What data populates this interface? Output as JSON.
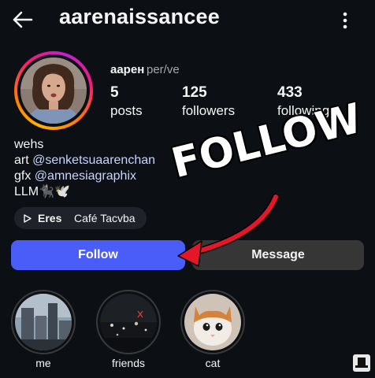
{
  "header": {
    "username": "aarenaissancee",
    "back_icon": "arrow-left-icon",
    "menu_icon": "more-vertical-icon"
  },
  "profile": {
    "display_name": "аарен",
    "pronouns": "per/ve",
    "stats": [
      {
        "value": "5",
        "label": "posts"
      },
      {
        "value": "125",
        "label": "followers"
      },
      {
        "value": "433",
        "label": "following"
      }
    ]
  },
  "bio": {
    "line1": "wehs",
    "line2_prefix": "art ",
    "line2_mention": "@senketsuaarenchan",
    "line3_prefix": "gfx ",
    "line3_mention": "@amnesiagraphix",
    "line4": "LLM🐈‍⬛🕊️"
  },
  "music": {
    "artist": "Eres",
    "song": "Café Tacvba",
    "icon": "play-icon"
  },
  "actions": {
    "follow_label": "Follow",
    "message_label": "Message"
  },
  "highlights": [
    {
      "label": "me"
    },
    {
      "label": "friends"
    },
    {
      "label": "cat"
    }
  ],
  "overlay": {
    "text": "FOLLOW"
  },
  "colors": {
    "background": "#0c1014",
    "follow_button": "#4a5df9",
    "message_button": "#363636",
    "mention": "#c9d4ff",
    "arrow": "#e3162a"
  }
}
